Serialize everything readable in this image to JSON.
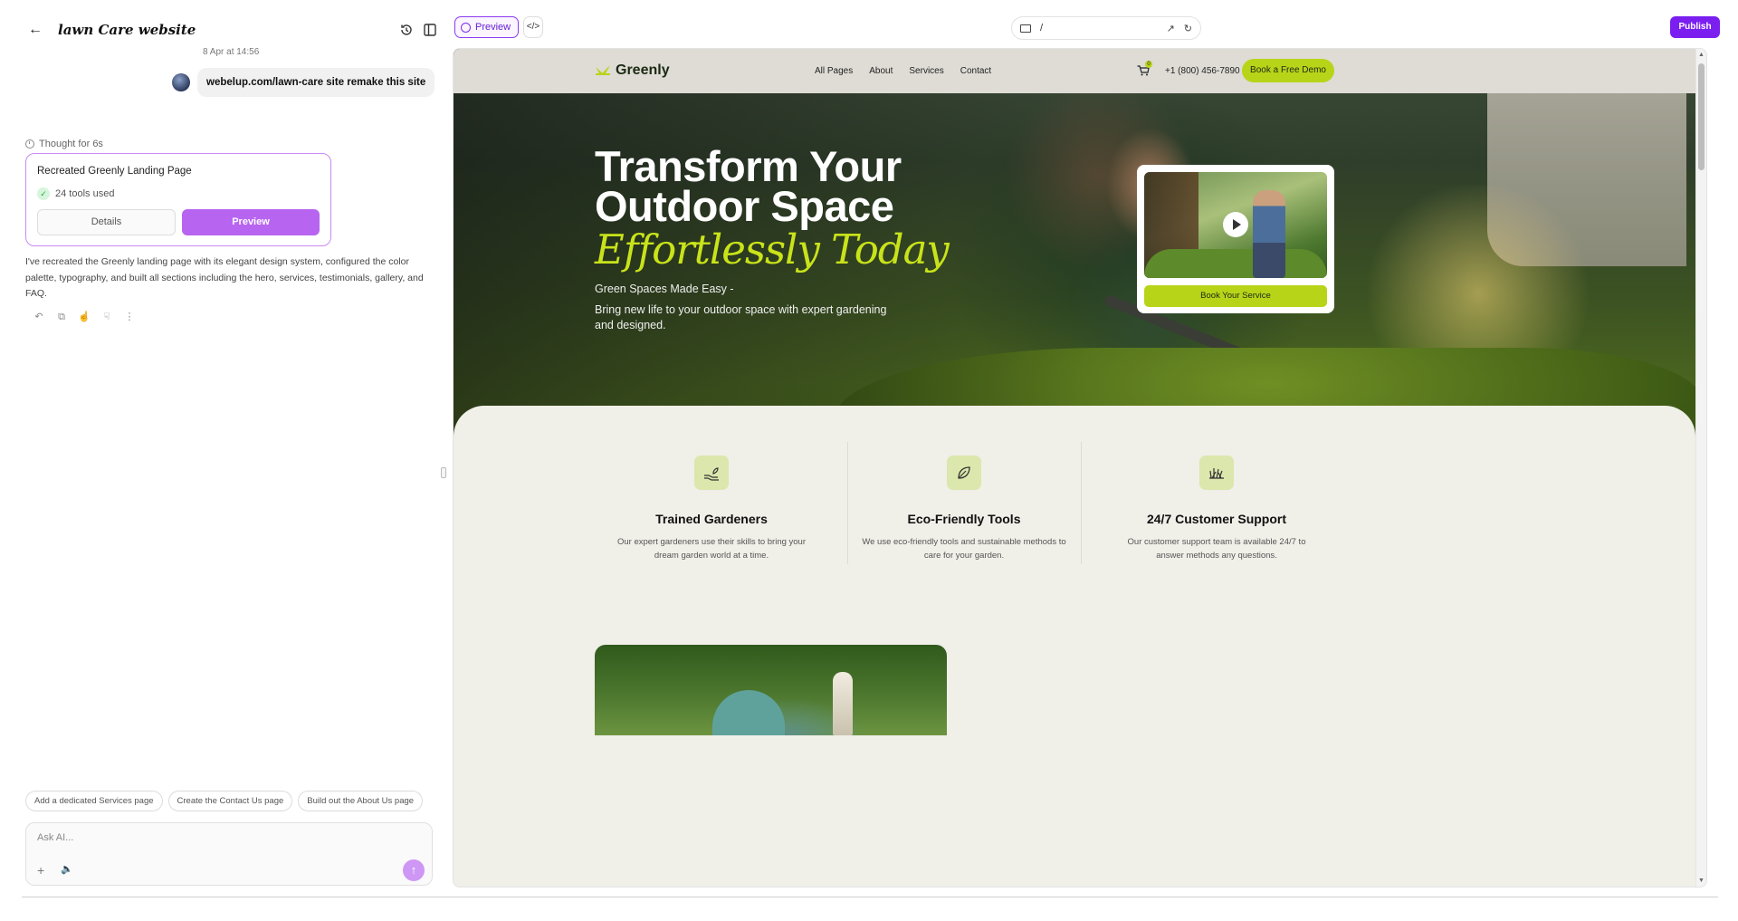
{
  "chat": {
    "project_title": "lawn Care website",
    "timestamp": "8 Apr at 14:56",
    "user_message": "webelup.com/lawn-care site remake this site",
    "thought": "Thought for 6s",
    "card": {
      "title": "Recreated Greenly Landing Page",
      "tools": "24 tools used",
      "details_label": "Details",
      "preview_label": "Preview"
    },
    "assistant_message": "I've recreated the Greenly landing page with its elegant design system, configured the color palette, typography, and built all sections including the hero, services, testimonials, gallery, and FAQ.",
    "suggestions": [
      "Add a dedicated Services page",
      "Create the Contact Us page",
      "Build out the About Us page"
    ],
    "composer_placeholder": "Ask AI..."
  },
  "toolbar": {
    "preview_tab": "Preview",
    "code_tab": "</>",
    "url": "/",
    "publish": "Publish"
  },
  "site": {
    "logo": "Greenly",
    "nav": [
      "All Pages",
      "About",
      "Services",
      "Contact"
    ],
    "cart_count": "0",
    "phone": "+1 (800) 456-7890",
    "demo_button": "Book a Free Demo",
    "hero": {
      "title_line1": "Transform Your",
      "title_line2": "Outdoor Space",
      "title_script": "Effortlessly Today",
      "subtitle": "Green Spaces Made Easy -",
      "description": "Bring new life to your outdoor space with expert gardening and designed.",
      "book_button": "Book Your Service"
    },
    "features": [
      {
        "title": "Trained Gardeners",
        "description": "Our expert gardeners use their skills to bring your dream garden world at a time.",
        "icon": "hand-plant-icon"
      },
      {
        "title": "Eco-Friendly Tools",
        "description": "We use eco-friendly tools and sustainable methods to care for your garden.",
        "icon": "leaf-icon"
      },
      {
        "title": "24/7 Customer Support",
        "description": "Our customer support team is available 24/7 to answer methods any questions.",
        "icon": "grass-icon"
      }
    ]
  },
  "colors": {
    "accent_purple": "#7a1ff0",
    "card_border": "#c98af5",
    "lime": "#b8d419",
    "script_lime": "#c9e31a",
    "feature_bg": "#f0efe8"
  }
}
